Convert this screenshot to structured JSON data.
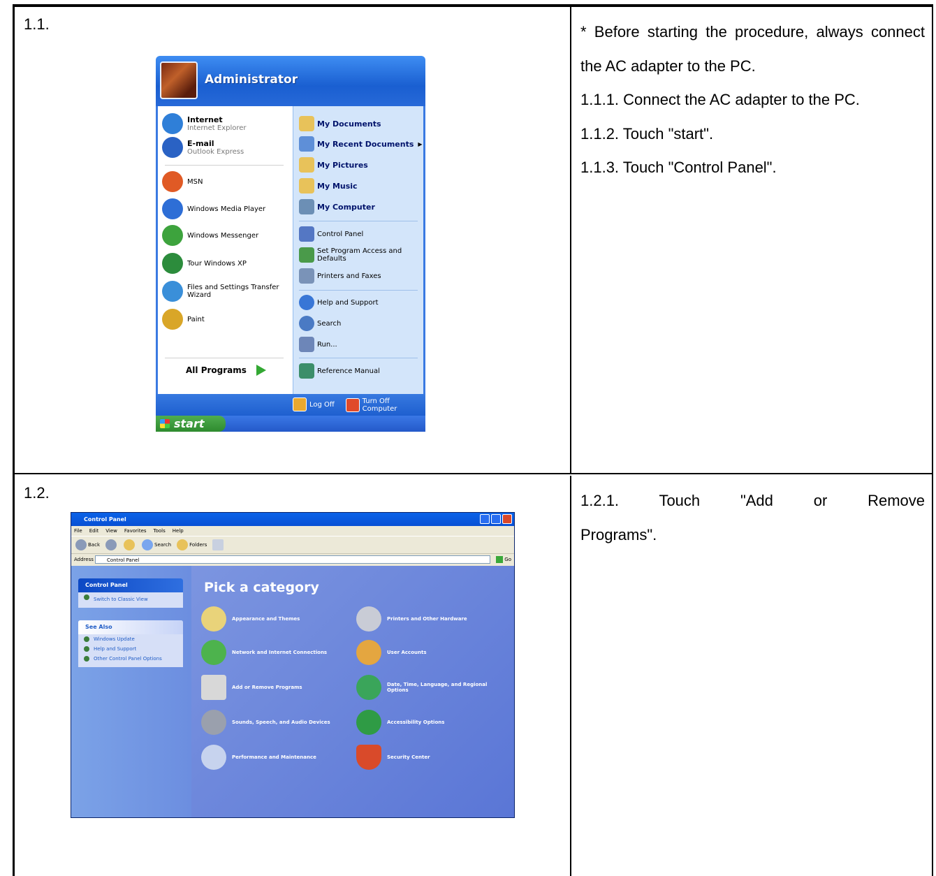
{
  "step1": {
    "label": "1.1.",
    "note": "* Before starting the procedure, always connect the AC adapter to the PC.",
    "instructions": [
      "1.1.1. Connect the AC adapter to the PC.",
      "1.1.2. Touch \"start\".",
      "1.1.3. Touch \"Control Panel\"."
    ]
  },
  "step2": {
    "label": "1.2.",
    "instructions": [
      "1.2.1. Touch \"Add or Remove Programs\"."
    ]
  },
  "start_menu": {
    "user": "Administrator",
    "left_items": [
      {
        "title": "Internet",
        "sub": "Internet Explorer",
        "color": "#2f7fd8"
      },
      {
        "title": "E-mail",
        "sub": "Outlook Express",
        "color": "#2a62c4"
      },
      {
        "label": "MSN",
        "color": "#e05a25"
      },
      {
        "label": "Windows Media Player",
        "color": "#2e6ed6"
      },
      {
        "label": "Windows Messenger",
        "color": "#3da33d"
      },
      {
        "label": "Tour Windows XP",
        "color": "#2c8c3c"
      },
      {
        "label": "Files and Settings Transfer Wizard",
        "color": "#3a8fd9"
      },
      {
        "label": "Paint",
        "color": "#d9a628"
      }
    ],
    "all_programs": "All Programs",
    "right_items": [
      {
        "label": "My Documents",
        "color": "#e8c25a"
      },
      {
        "label": "My Recent Documents",
        "color": "#5e8fd8"
      },
      {
        "label": "My Pictures",
        "color": "#e8c25a"
      },
      {
        "label": "My Music",
        "color": "#e8c25a"
      },
      {
        "label": "My Computer",
        "color": "#6c8fb5"
      },
      {
        "label": "Control Panel",
        "color": "#5477c4"
      },
      {
        "label": "Set Program Access and Defaults",
        "color": "#4a9a4a"
      },
      {
        "label": "Printers and Faxes",
        "color": "#7a93b8"
      },
      {
        "label": "Help and Support",
        "color": "#3876d6"
      },
      {
        "label": "Search",
        "color": "#4a7ac4"
      },
      {
        "label": "Run...",
        "color": "#6d86b8"
      },
      {
        "label": "Reference Manual",
        "color": "#3c8e6a"
      }
    ],
    "log_off": "Log Off",
    "turn_off": "Turn Off Computer",
    "start": "start"
  },
  "control_panel": {
    "title": "Control Panel",
    "menu": [
      "File",
      "Edit",
      "View",
      "Favorites",
      "Tools",
      "Help"
    ],
    "toolbar": {
      "back": "Back",
      "search": "Search",
      "folders": "Folders"
    },
    "address_label": "Address",
    "address_value": "Control Panel",
    "go": "Go",
    "side_title": "Control Panel",
    "switch_view": "Switch to Classic View",
    "see_also_title": "See Also",
    "see_also": [
      "Windows Update",
      "Help and Support",
      "Other Control Panel Options"
    ],
    "heading": "Pick a category",
    "categories": [
      {
        "label": "Appearance and Themes",
        "color": "#e9d37a"
      },
      {
        "label": "Printers and Other Hardware",
        "color": "#c9ccd6"
      },
      {
        "label": "Network and Internet Connections",
        "color": "#4db34d"
      },
      {
        "label": "User Accounts",
        "color": "#e4a640"
      },
      {
        "label": "Add or Remove Programs",
        "color": "#d8d8d8"
      },
      {
        "label": "Date, Time, Language, and Regional Options",
        "color": "#3aa55a"
      },
      {
        "label": "Sounds, Speech, and Audio Devices",
        "color": "#9aa0ad"
      },
      {
        "label": "Accessibility Options",
        "color": "#2f9b45"
      },
      {
        "label": "Performance and Maintenance",
        "color": "#c7d3ee"
      },
      {
        "label": "Security Center",
        "color": "#d94a2a"
      }
    ]
  }
}
